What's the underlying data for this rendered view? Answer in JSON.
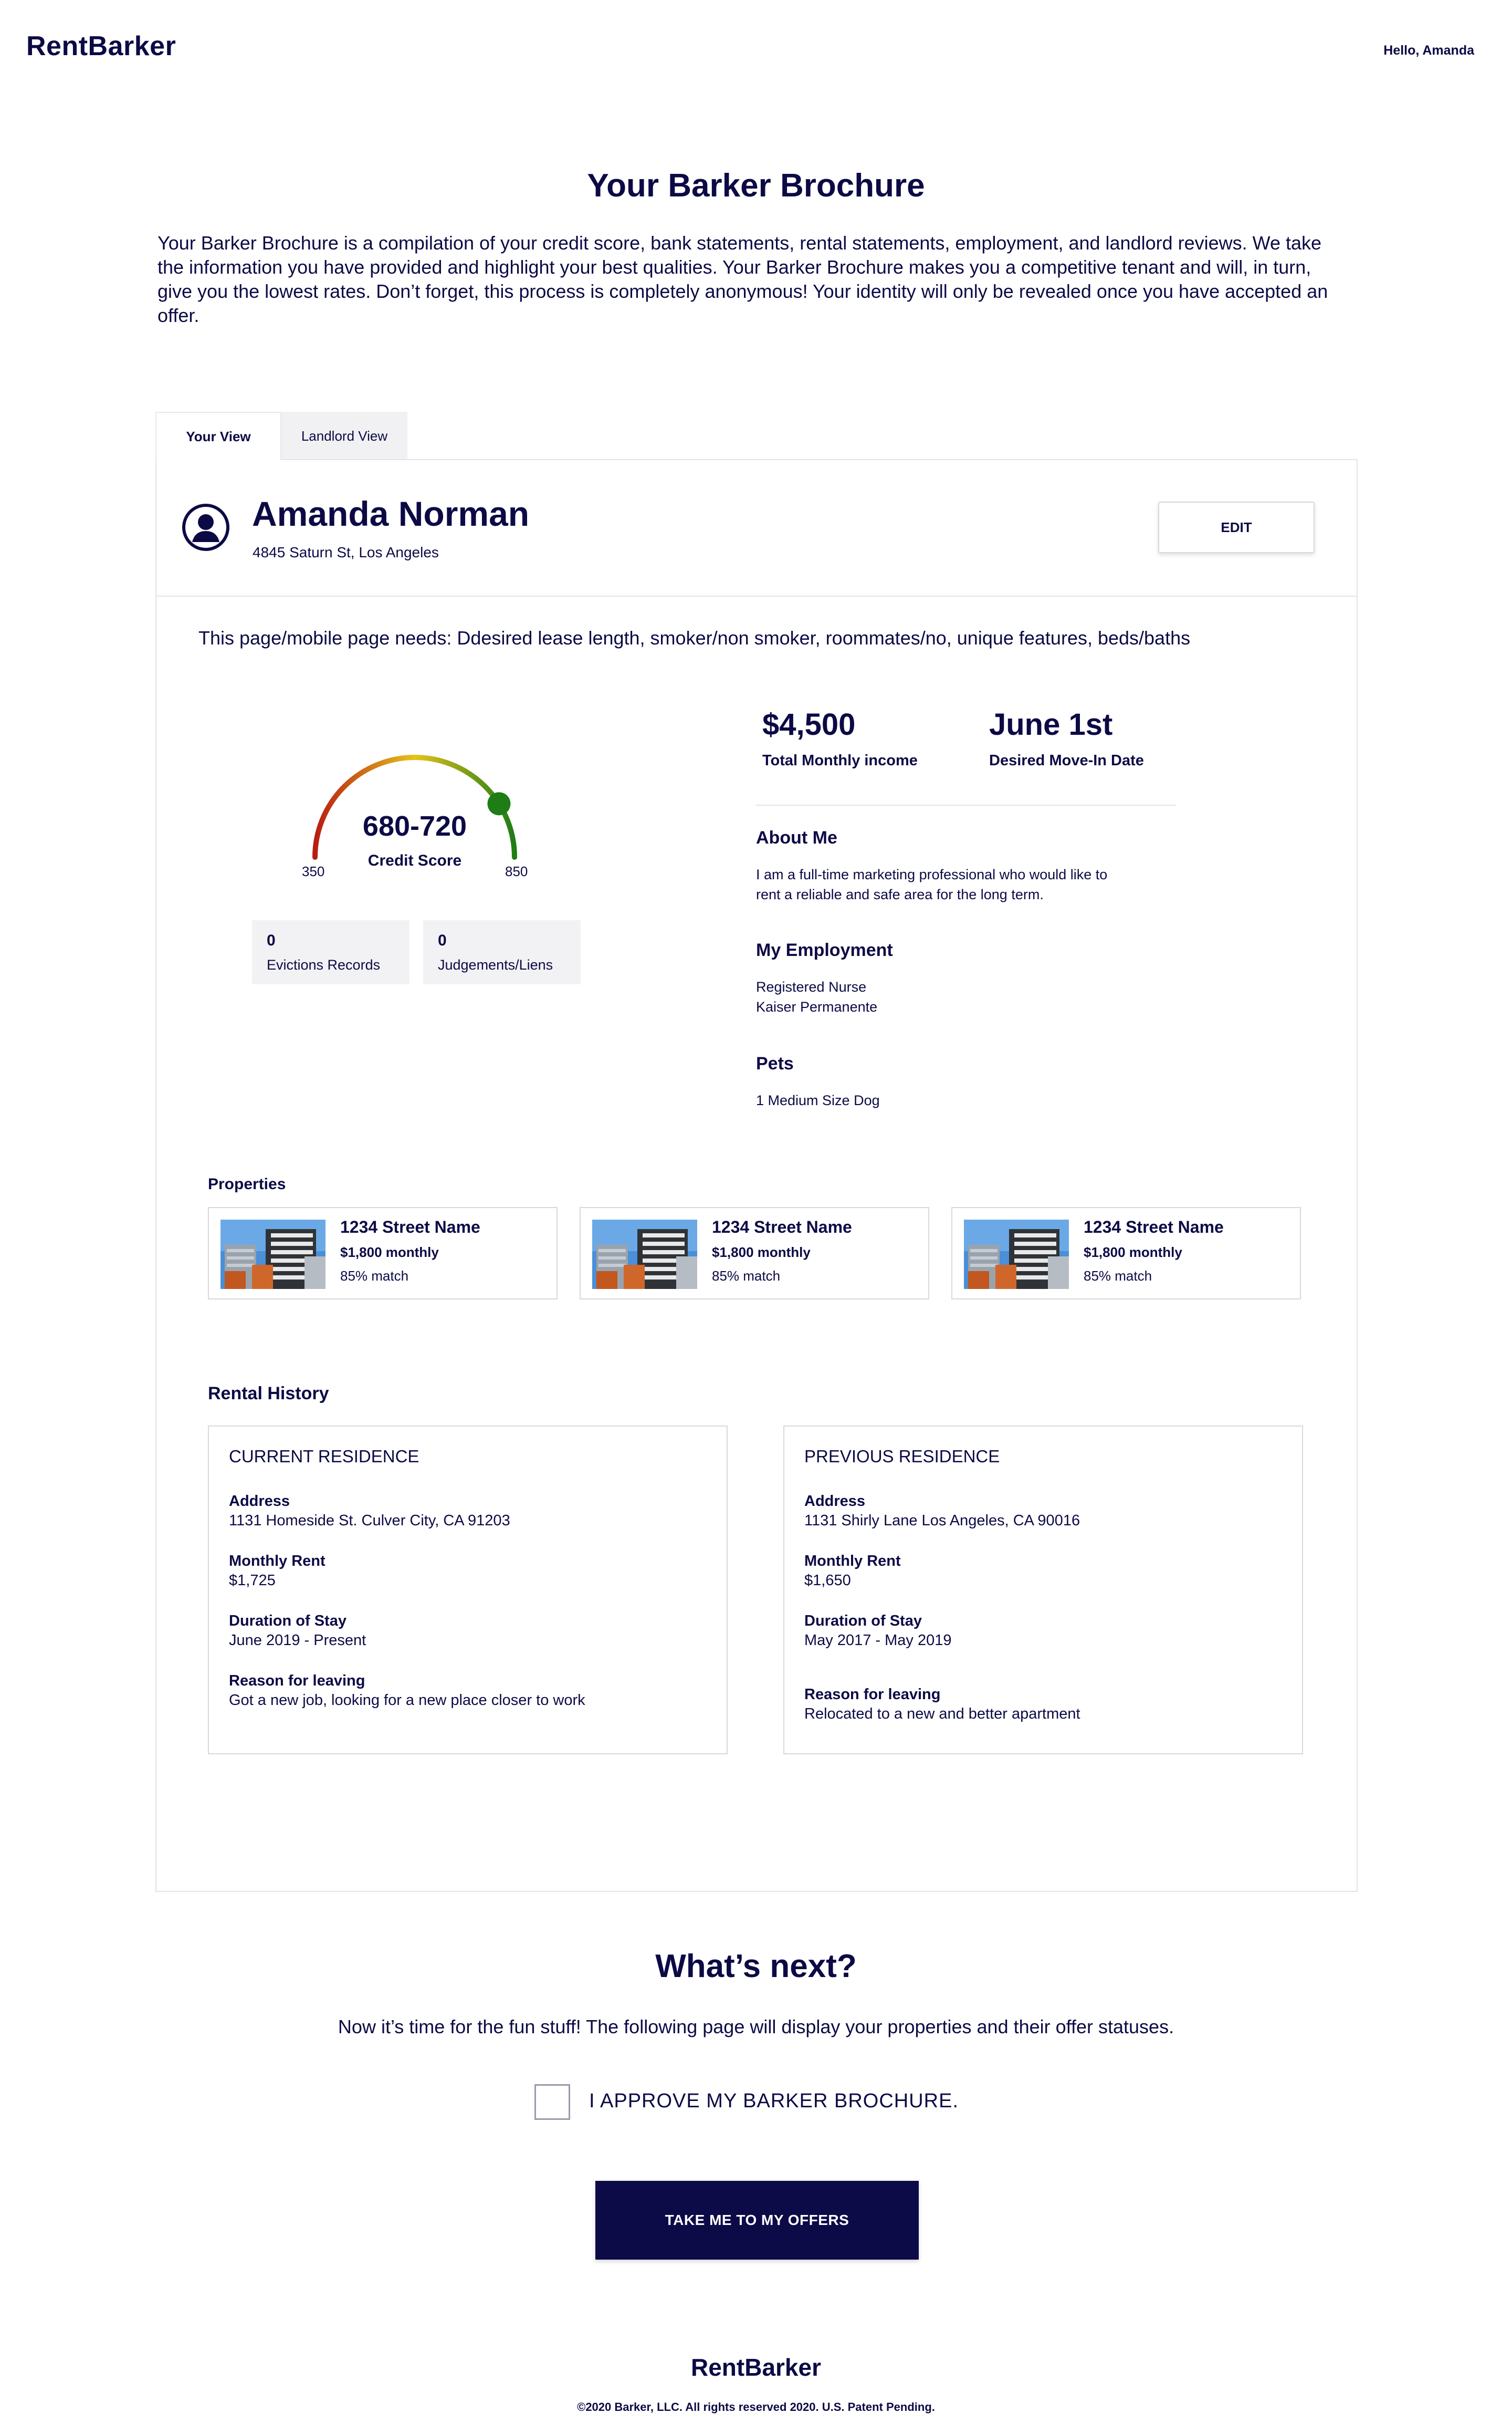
{
  "header": {
    "logo": "RentBarker",
    "greeting": "Hello, Amanda"
  },
  "intro": {
    "title": "Your Barker Brochure",
    "text": " Your Barker Brochure is a compilation of your credit score, bank statements, rental statements, employment, and landlord reviews. We take the information you have provided and highlight your best qualities. Your Barker Brochure makes you a competitive tenant and will, in turn, give you the lowest rates. Don’t forget, this process is completely anonymous! Your identity will only be revealed once you have accepted an offer."
  },
  "tabs": [
    {
      "label": "Your View",
      "active": true
    },
    {
      "label": "Landlord View",
      "active": false
    }
  ],
  "profile": {
    "name": "Amanda Norman",
    "address": "4845 Saturn St, Los Angeles",
    "edit_label": "EDIT",
    "avatar_icon": "user-circle-icon"
  },
  "needs_note": "This page/mobile page needs: Ddesired lease length, smoker/non smoker, roommates/no, unique features, beds/baths",
  "credit": {
    "range": "680-720",
    "label": "Credit Score",
    "min": "350",
    "max": "850",
    "fraction": 0.82,
    "colors": {
      "low": "#b81d12",
      "mid": "#e6c21a",
      "high": "#1e7d14"
    }
  },
  "records": {
    "evictions_value": "0",
    "evictions_label": "Evictions Records",
    "judgements_value": "0",
    "judgements_label": "Judgements/Liens"
  },
  "summary": {
    "income_value": "$4,500",
    "income_label": "Total Monthly income",
    "move_value": "June 1st",
    "move_label": "Desired Move-In Date"
  },
  "about": {
    "heading": "About Me",
    "text": "I am a full-time marketing professional who would like to rent a reliable and safe area for the long term."
  },
  "employment": {
    "heading": "My Employment",
    "line1": "Registered Nurse",
    "line2": "Kaiser Permanente"
  },
  "pets": {
    "heading": "Pets",
    "text": "1 Medium Size Dog"
  },
  "properties": {
    "heading": "Properties",
    "items": [
      {
        "name": "1234 Street Name",
        "price": "$1,800 monthly",
        "match": "85% match"
      },
      {
        "name": "1234 Street Name",
        "price": "$1,800 monthly",
        "match": "85% match"
      },
      {
        "name": "1234 Street Name",
        "price": "$1,800 monthly",
        "match": "85% match"
      }
    ]
  },
  "rental_history": {
    "heading": "Rental History",
    "current": {
      "title": "CURRENT RESIDENCE",
      "address_label": "Address",
      "address": "1131 Homeside St. Culver City, CA 91203",
      "rent_label": "Monthly Rent",
      "rent": "$1,725",
      "duration_label": "Duration of Stay",
      "duration": "June 2019 - Present",
      "reason_label": "Reason for leaving",
      "reason": "Got a new job, looking for a new place closer to work"
    },
    "previous": {
      "title": "PREVIOUS RESIDENCE",
      "address_label": "Address",
      "address": "1131 Shirly Lane Los Angeles, CA 90016",
      "rent_label": "Monthly Rent",
      "rent": "$1,650",
      "duration_label": "Duration of Stay",
      "duration": "May 2017 - May 2019",
      "reason_label": "Reason for leaving",
      "reason": "Relocated to a new and better apartment"
    }
  },
  "next": {
    "title": "What’s next?",
    "text": "Now it’s time for the fun stuff! The following page will display your properties and their offer statuses.",
    "approve_label": "I APPROVE MY BARKER BROCHURE.",
    "approved": false,
    "button_label": "TAKE ME TO MY OFFERS"
  },
  "footer": {
    "logo": "RentBarker",
    "copyright": "©2020 Barker, LLC. All rights reserved 2020. U.S. Patent Pending."
  },
  "colors": {
    "brand": "#0c0a45",
    "button_bg": "#0d0a48",
    "panel_bg": "#f2f2f5",
    "border": "#e3e3ea"
  }
}
